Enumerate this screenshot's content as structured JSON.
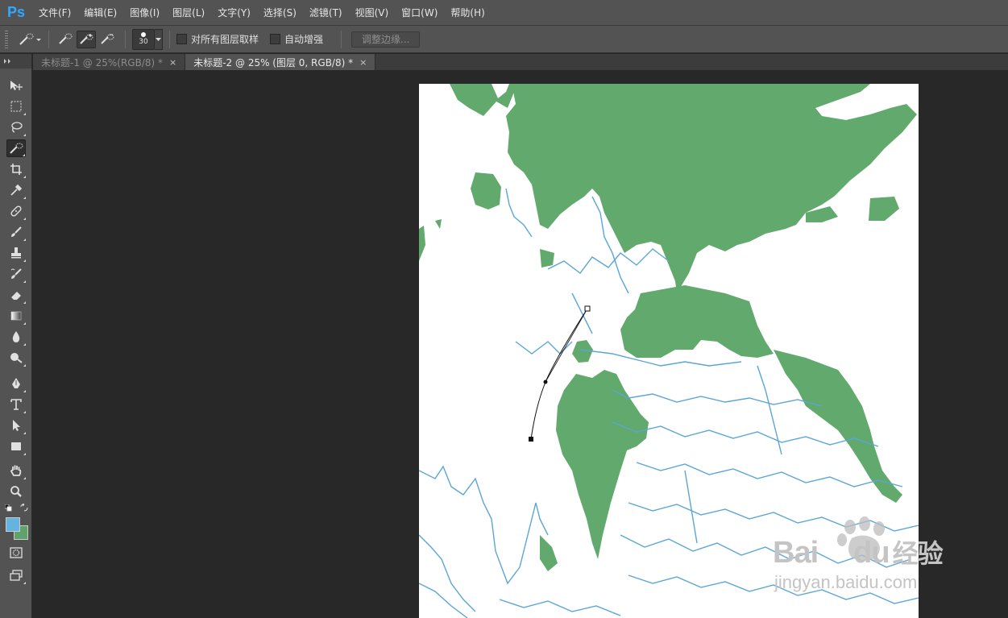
{
  "app": {
    "logo": "Ps"
  },
  "menu": [
    {
      "label": "文件(F)"
    },
    {
      "label": "编辑(E)"
    },
    {
      "label": "图像(I)"
    },
    {
      "label": "图层(L)"
    },
    {
      "label": "文字(Y)"
    },
    {
      "label": "选择(S)"
    },
    {
      "label": "滤镜(T)"
    },
    {
      "label": "视图(V)"
    },
    {
      "label": "窗口(W)"
    },
    {
      "label": "帮助(H)"
    }
  ],
  "options": {
    "brush_size": "30",
    "sample_all_layers": "对所有图层取样",
    "auto_enhance": "自动增强",
    "refine_edge": "调整边缘..."
  },
  "tabs": [
    {
      "label": "未标题-1 @ 25%(RGB/8) *",
      "close": "×",
      "active": false
    },
    {
      "label": "未标题-2 @ 25% (图层 0, RGB/8) *",
      "close": "×",
      "active": true
    }
  ],
  "colors": {
    "foreground": "#64b4e0",
    "background": "#5fa36b",
    "brand": "#31a8ff",
    "canvas_green": "#62a96e",
    "canvas_blue": "#5aa6d6"
  },
  "tools": [
    "move-icon",
    "marquee-icon",
    "lasso-icon",
    "quick-selection-icon",
    "crop-icon",
    "eyedropper-icon",
    "healing-brush-icon",
    "brush-icon",
    "clone-stamp-icon",
    "history-brush-icon",
    "eraser-icon",
    "gradient-icon",
    "blur-icon",
    "dodge-icon",
    "pen-icon",
    "type-icon",
    "path-selection-icon",
    "rectangle-icon",
    "hand-icon",
    "zoom-icon"
  ],
  "watermark": {
    "brand": "Bai",
    "brand2": "du",
    "product": "经验",
    "url": "jingyan.baidu.com"
  }
}
